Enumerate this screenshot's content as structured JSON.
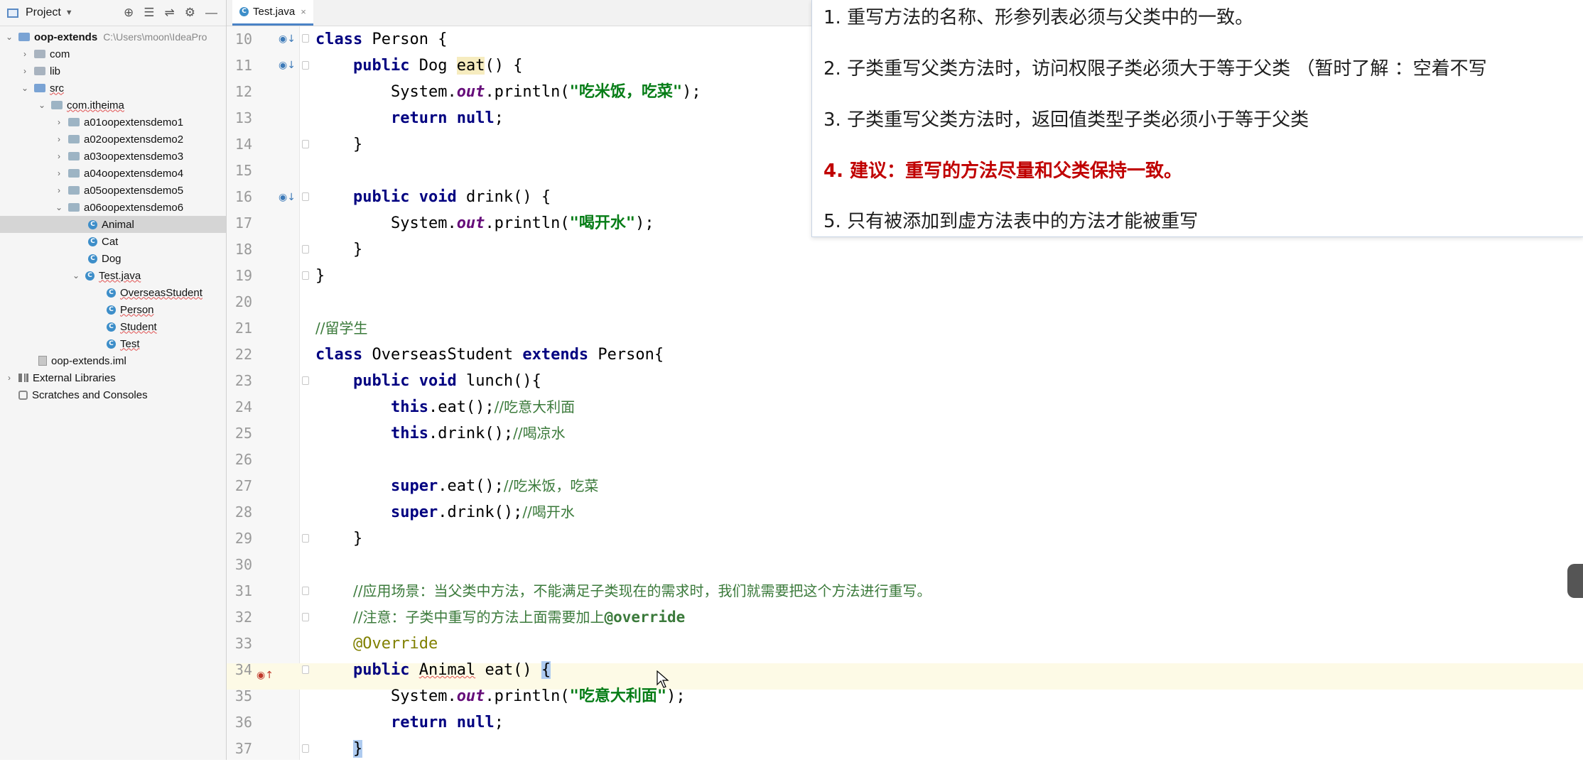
{
  "project_panel": {
    "title": "Project",
    "tree": [
      {
        "label": "oop-extends",
        "path": "C:\\Users\\moon\\IdeaPro",
        "icon": "module-folder-icon",
        "expanded": true
      },
      {
        "label": "com",
        "icon": "folder-icon",
        "expanded": false
      },
      {
        "label": "lib",
        "icon": "folder-icon",
        "expanded": false
      },
      {
        "label": "src",
        "icon": "source-folder-icon",
        "expanded": true
      },
      {
        "label": "com.itheima",
        "icon": "package-icon",
        "expanded": true
      },
      {
        "label": "a01oopextensdemo1",
        "icon": "package-icon",
        "expanded": false
      },
      {
        "label": "a02oopextensdemo2",
        "icon": "package-icon",
        "expanded": false
      },
      {
        "label": "a03oopextensdemo3",
        "icon": "package-icon",
        "expanded": false
      },
      {
        "label": "a04oopextensdemo4",
        "icon": "package-icon",
        "expanded": false
      },
      {
        "label": "a05oopextensdemo5",
        "icon": "package-icon",
        "expanded": false
      },
      {
        "label": "a06oopextensdemo6",
        "icon": "package-icon",
        "expanded": true
      },
      {
        "label": "Animal",
        "icon": "class-icon",
        "selected": true
      },
      {
        "label": "Cat",
        "icon": "class-icon"
      },
      {
        "label": "Dog",
        "icon": "class-icon"
      },
      {
        "label": "Test.java",
        "icon": "class-icon",
        "expanded": true
      },
      {
        "label": "OverseasStudent",
        "icon": "class-icon"
      },
      {
        "label": "Person",
        "icon": "class-icon"
      },
      {
        "label": "Student",
        "icon": "class-icon"
      },
      {
        "label": "Test",
        "icon": "class-icon"
      },
      {
        "label": "oop-extends.iml",
        "icon": "file-icon"
      },
      {
        "label": "External Libraries",
        "icon": "library-icon",
        "expanded": false
      },
      {
        "label": "Scratches and Consoles",
        "icon": "scratches-icon"
      }
    ]
  },
  "editor": {
    "tab": {
      "label": "Test.java",
      "close": "×"
    },
    "line_numbers": [
      "10",
      "11",
      "12",
      "13",
      "14",
      "15",
      "16",
      "17",
      "18",
      "19",
      "20",
      "21",
      "22",
      "23",
      "24",
      "25",
      "26",
      "27",
      "28",
      "29",
      "30",
      "31",
      "32",
      "33",
      "34",
      "35",
      "36",
      "37"
    ],
    "code": {
      "l10": {
        "kw": "class",
        "rest": " Person {"
      },
      "l11": {
        "kw": "public",
        "t1": " Dog ",
        "name": "eat",
        "t2": "() {"
      },
      "l12": {
        "pre": "System.",
        "field": "out",
        "mid": ".println(",
        "str": "\"吃米饭，吃菜\"",
        "post": ");"
      },
      "l13": {
        "kw": "return",
        "sp": " ",
        "kw2": "null",
        "post": ";"
      },
      "l14": {
        "text": "}"
      },
      "l16": {
        "kw": "public",
        "sp": " ",
        "kw2": "void",
        "rest": " drink() {"
      },
      "l17": {
        "pre": "System.",
        "field": "out",
        "mid": ".println(",
        "str": "\"喝开水\"",
        "post": ");"
      },
      "l18": {
        "text": "}"
      },
      "l19": {
        "text": "}"
      },
      "l21": {
        "comment": "//留学生"
      },
      "l22": {
        "kw": "class",
        "t1": " OverseasStudent ",
        "kw2": "extends",
        "t2": " Person{"
      },
      "l23": {
        "kw": "public",
        "sp": " ",
        "kw2": "void",
        "rest": " lunch(){"
      },
      "l24": {
        "kw": "this",
        "rest": ".eat();",
        "comment": "//吃意大利面"
      },
      "l25": {
        "kw": "this",
        "rest": ".drink();",
        "comment": "//喝凉水"
      },
      "l27": {
        "kw": "super",
        "rest": ".eat();",
        "comment": "//吃米饭，吃菜"
      },
      "l28": {
        "kw": "super",
        "rest": ".drink();",
        "comment": "//喝开水"
      },
      "l29": {
        "text": "}"
      },
      "l31": {
        "comment": "//应用场景：当父类中方法，不能满足子类现在的需求时，我们就需要把这个方法进行重写。"
      },
      "l32": {
        "comment": "//注意：子类中重写的方法上面需要加上",
        "tag": "@override"
      },
      "l33": {
        "annotation": "@Override"
      },
      "l34": {
        "kw": "public",
        "sp": " ",
        "type": "Animal",
        "rest": " eat() ",
        "brace": "{"
      },
      "l35": {
        "pre": "System.",
        "field": "out",
        "mid": ".println(",
        "str": "\"吃意大利面\"",
        "post": ");"
      },
      "l36": {
        "kw": "return",
        "sp": " ",
        "kw2": "null",
        "post": ";"
      },
      "l37": {
        "brace": "}"
      }
    }
  },
  "notes": [
    {
      "num": "1.",
      "text": "重写方法的名称、形参列表必须与父类中的一致。",
      "emphasis": false
    },
    {
      "num": "2.",
      "text": "子类重写父类方法时，访问权限子类必须大于等于父类 （暂时了解 ：空着不写",
      "emphasis": false
    },
    {
      "num": "3.",
      "text": "子类重写父类方法时，返回值类型子类必须小于等于父类",
      "emphasis": false
    },
    {
      "num": "4.",
      "text": "建议：重写的方法尽量和父类保持一致。",
      "emphasis": true
    },
    {
      "num": "5.",
      "text": "只有被添加到虚方法表中的方法才能被重写",
      "emphasis": false
    }
  ],
  "colors": {
    "emphasis": "#c00000",
    "keyword": "#000080",
    "string": "#067d17",
    "comment": "#3b7a3b",
    "annotation": "#808000"
  }
}
